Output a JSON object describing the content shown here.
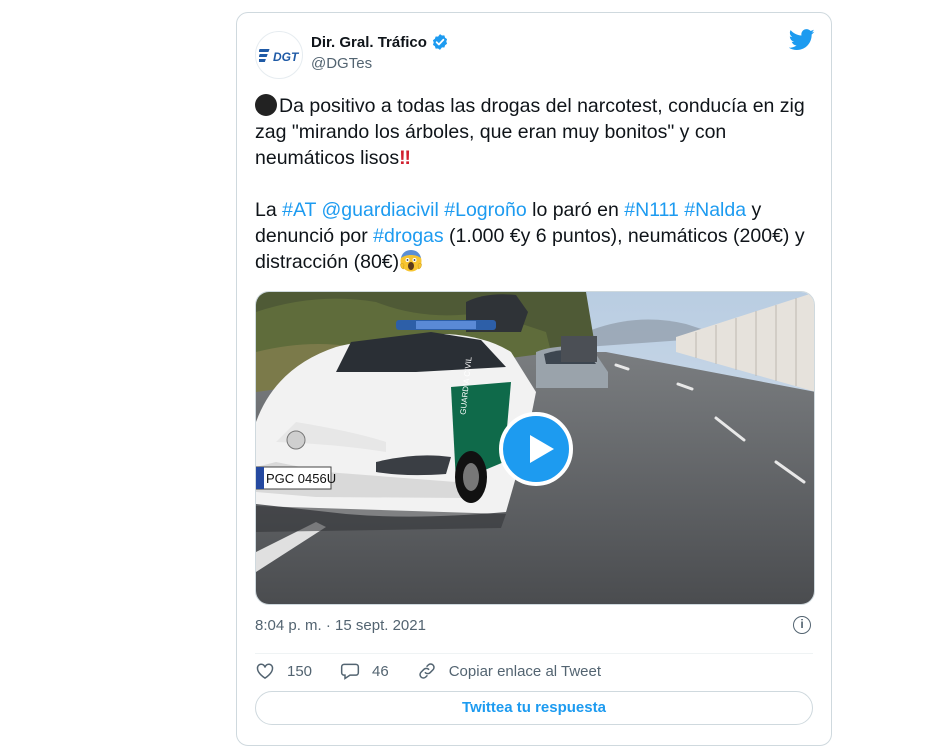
{
  "author": {
    "name": "Dir. Gral. Tráfico",
    "handle": "@DGTes",
    "logo_text": "DGT"
  },
  "tweet": {
    "line1": "Da positivo a todas las drogas del narcotest, conducía en zig zag \"mirando los árboles, que eran muy bonitos\" y con neumáticos lisos",
    "line1_bang": "‼",
    "p2_start": "La ",
    "tag_at": "#AT",
    "mention": "@guardiacivil",
    "tag_logrono": "#Logroño",
    "mid1": " lo paró en ",
    "tag_n111": "#N111",
    "tag_nalda": "#Nalda",
    "mid2": " y denunció por ",
    "tag_drogas": "#drogas",
    "tail": " (1.000 €y 6 puntos), neumáticos (200€) y distracción (80€)"
  },
  "media": {
    "plate": "PGC 0456U"
  },
  "meta": {
    "timestamp": "8:04 p. m. · 15 sept. 2021"
  },
  "actions": {
    "likes": "150",
    "replies": "46",
    "copy_link": "Copiar enlace al Tweet"
  },
  "reply_button": "Twittea tu respuesta",
  "colors": {
    "accent": "#1d9bf0",
    "text": "#0f1419",
    "muted": "#536471",
    "border": "#cfd9de"
  }
}
